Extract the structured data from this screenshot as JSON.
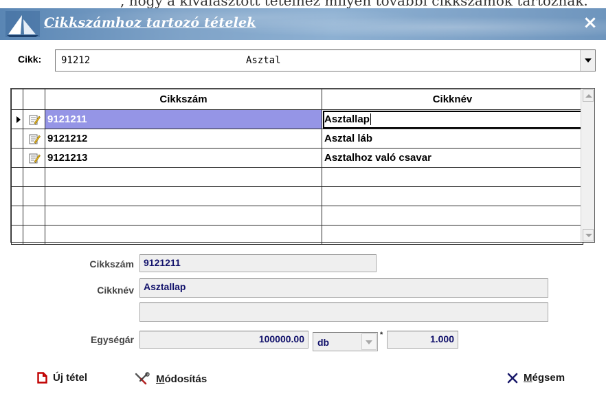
{
  "top_strip_text": ", hogy a kiválasztott tételhez milyen további cikkszámok tartoznak.",
  "window": {
    "title": "Cikkszámhoz tartozó tételek",
    "close_glyph": "×"
  },
  "cikk": {
    "label": "Cikk:",
    "code": "91212",
    "name": "Asztal"
  },
  "grid": {
    "columns": [
      "Cikkszám",
      "Cikknév"
    ],
    "rows": [
      {
        "code": "9121211",
        "name": "Asztallap",
        "selected": true
      },
      {
        "code": "9121212",
        "name": "Asztal láb",
        "selected": false
      },
      {
        "code": "9121213",
        "name": "Asztalhoz való csavar",
        "selected": false
      }
    ],
    "empty_row_count": 4
  },
  "details": {
    "cikkszam_label": "Cikkszám",
    "cikkszam_value": "9121211",
    "cikknev_label": "Cikknév",
    "cikknev_value": "Asztallap",
    "extra_value": "",
    "egysegar_label": "Egységár",
    "egysegar_value": "100000.00",
    "unit_value": "db",
    "multiplier_symbol": "*",
    "quantity_value": "1.000"
  },
  "buttons": {
    "new_item": {
      "label": "Új tétel",
      "icon": "document-icon"
    },
    "modify": {
      "label_accel": "M",
      "label_rest": "ódosítás",
      "icon": "tools-icon"
    },
    "cancel": {
      "label_accel": "M",
      "label_rest": "égsem",
      "icon": "x-icon"
    }
  },
  "colors": {
    "titlebar": "#7fa3c8",
    "selection": "#9595e6",
    "field_bg": "#efefef",
    "field_text": "#10106a",
    "cancel_icon": "#1a1a6a",
    "new_item_icon": "#c00000"
  }
}
